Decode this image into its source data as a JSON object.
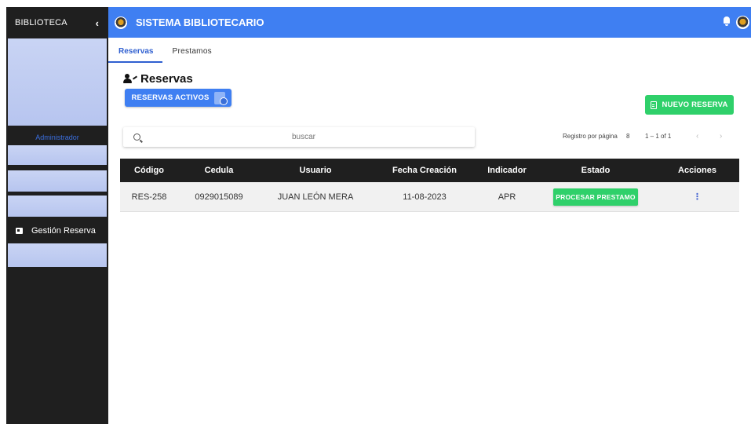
{
  "sidebar": {
    "title": "BIBLIOTECA",
    "toggle_icon": "chevron-left-icon",
    "role": "Administrador",
    "items": [
      {
        "label": "Gestión Reserva",
        "icon": "archive-icon"
      }
    ]
  },
  "header": {
    "title": "SISTEMA BIBLIOTECARIO",
    "notification_icon": "bell-icon",
    "accent_color": "#3f7ff2"
  },
  "tabs": [
    {
      "label": "Reservas",
      "active": true
    },
    {
      "label": "Prestamos",
      "active": false
    }
  ],
  "page": {
    "title": "Reservas",
    "title_icon": "users-icon"
  },
  "buttons": {
    "activos": "RESERVAS ACTIVOS",
    "nuevo": "NUEVO RESERVA"
  },
  "search": {
    "placeholder": "buscar",
    "value": ""
  },
  "pagination": {
    "label": "Registro por página",
    "page_size": "8",
    "range": "1 – 1 of 1",
    "prev": "‹",
    "next": "›"
  },
  "table": {
    "headers": [
      "Código",
      "Cedula",
      "Usuario",
      "Fecha Creación",
      "Indicador",
      "Estado",
      "Acciones"
    ],
    "rows": [
      {
        "codigo": "RES-258",
        "cedula": "0929015089",
        "usuario": "JUAN LEÓN MERA",
        "fecha": "11-08-2023",
        "indicador": "APR",
        "estado_button": "PROCESAR PRESTAMO",
        "acciones": "⋮"
      }
    ]
  },
  "colors": {
    "success": "#2fd06a",
    "sidebar_bg": "#1f1f1f",
    "table_header_bg": "#1f1f1f"
  }
}
